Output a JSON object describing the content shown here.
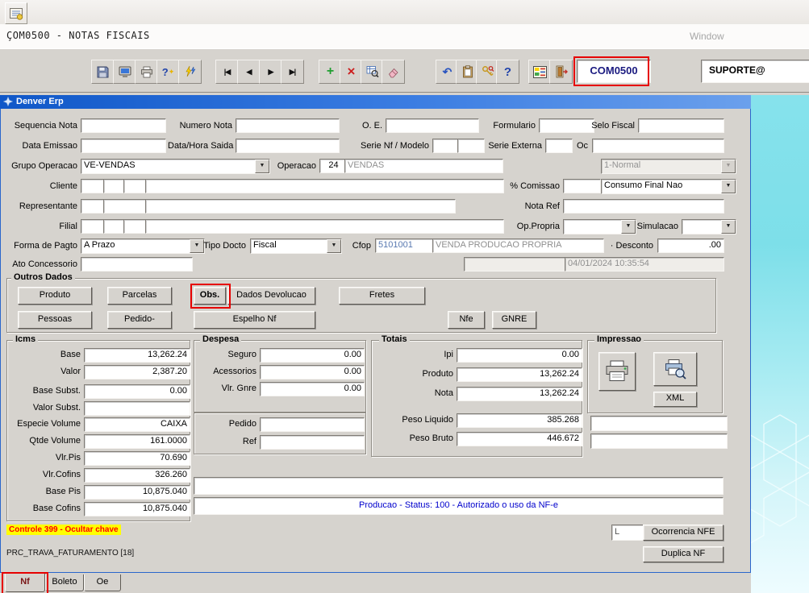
{
  "titlebar": {
    "title": "ÇOM0500 - NOTAS FISCAIS",
    "window_menu": "Window"
  },
  "toolbar": {
    "app_code": "COM0500",
    "user": "SUPORTE@",
    "icons": {
      "save": "floppy",
      "screen": "monitor",
      "print": "printer",
      "hint": "?",
      "execute": "lightning",
      "first": "|◀",
      "prev": "◀",
      "next": "▶",
      "last": "▶|",
      "insert": "+",
      "delete": "×",
      "query": "magnifier-grid",
      "clear": "eraser",
      "undo": "↶",
      "paste": "clipboard",
      "keys": "keys",
      "help": "?",
      "menu": "menu-grid",
      "exit": "door"
    }
  },
  "frame": {
    "title": "Denver Erp"
  },
  "form": {
    "sequencia_nota_label": "Sequencia Nota",
    "numero_nota_label": "Numero Nota",
    "oe_label": "O. E.",
    "formulario_label": "Formulario",
    "selo_fiscal_label": "Selo Fiscal",
    "data_emissao_label": "Data Emissao",
    "data_hora_saida_label": "Data/Hora Saida",
    "serie_nf_label": "Serie Nf / Modelo",
    "serie_externa_label": "Serie Externa",
    "oc_label": "Oc",
    "grupo_operacao_label": "Grupo Operacao",
    "grupo_operacao_value": "VE-VENDAS",
    "operacao_label": "Operacao",
    "operacao_value": "24",
    "operacao_desc": "VENDAS",
    "tipo_nota_value": "1-Normal",
    "cliente_label": "Cliente",
    "comissao_label": "% Comissao",
    "consumo_final_value": "Consumo Final Nao",
    "representante_label": "Representante",
    "nota_ref_label": "Nota Ref",
    "filial_label": "Filial",
    "op_propria_label": "Op.Propria",
    "simulacao_label": "Simulacao",
    "forma_pagto_label": "Forma de Pagto",
    "forma_pagto_value": "A Prazo",
    "tipo_docto_label": "Tipo Docto",
    "tipo_docto_value": "Fiscal",
    "cfop_label": "Cfop",
    "cfop_value": "5101001",
    "cfop_desc": "VENDA PRODUCAO PROPRIA",
    "desconto_label": "· Desconto",
    "desconto_value": ".00",
    "ato_concessorio_label": "Ato Concessorio",
    "data_autorizacao": "04/01/2024 10:35:54"
  },
  "outros_dados": {
    "title": "Outros Dados",
    "buttons": [
      "Produto",
      "Parcelas",
      "Obs.",
      "Dados Devolucao",
      "Fretes",
      "Pessoas",
      "Pedido-",
      "Espelho Nf",
      "Nfe",
      "GNRE"
    ]
  },
  "icms": {
    "title": "Icms",
    "rows": [
      {
        "label": "Base",
        "value": "13,262.24"
      },
      {
        "label": "Valor",
        "value": "2,387.20"
      },
      {
        "label": "Base Subst.",
        "value": "0.00"
      },
      {
        "label": "Valor Subst.",
        "value": ""
      },
      {
        "label": "Especie Volume",
        "value": "CAIXA"
      },
      {
        "label": "Qtde Volume",
        "value": "161.0000"
      },
      {
        "label": "Vlr.Pis",
        "value": "70.690"
      },
      {
        "label": "Vlr.Cofins",
        "value": "326.260"
      },
      {
        "label": "Base Pis",
        "value": "10,875.040"
      },
      {
        "label": "Base Cofins",
        "value": "10,875.040"
      }
    ]
  },
  "despesa": {
    "title": "Despesa",
    "rows": [
      {
        "label": "Seguro",
        "value": "0.00"
      },
      {
        "label": "Acessorios",
        "value": "0.00"
      },
      {
        "label": "Vlr. Gnre",
        "value": "0.00"
      }
    ],
    "pedido_label": "Pedido",
    "ref_label": "Ref"
  },
  "totais": {
    "title": "Totais",
    "rows": [
      {
        "label": "Ipi",
        "value": "0.00"
      },
      {
        "label": "Produto",
        "value": "13,262.24"
      },
      {
        "label": "Nota",
        "value": "13,262.24"
      },
      {
        "label": "Peso Liquido",
        "value": "385.268"
      },
      {
        "label": "Peso Bruto",
        "value": "446.672"
      }
    ]
  },
  "impressao": {
    "title": "Impressao",
    "xml_button": "XML"
  },
  "status": {
    "nfe_status": "Producao - Status: 100 - Autorizado o uso da NF-e",
    "controle": "Controle 399 -  Ocultar chave",
    "prc": "PRC_TRAVA_FATURAMENTO [18]",
    "l_value": "L",
    "ocorrencia_button": "Ocorrencia NFE",
    "duplica_button": "Duplica NF"
  },
  "tabs": [
    {
      "label": "Nf"
    },
    {
      "label": "Boleto"
    },
    {
      "label": "Oe"
    }
  ],
  "colors": {
    "annotation_red": "#e60000",
    "frame_blue": "#2a66cc",
    "status_blue": "#0000cc",
    "alert_red": "#ff0000",
    "alert_yellow": "#ffff00",
    "desktop_cyan": "#7fdfe9"
  }
}
